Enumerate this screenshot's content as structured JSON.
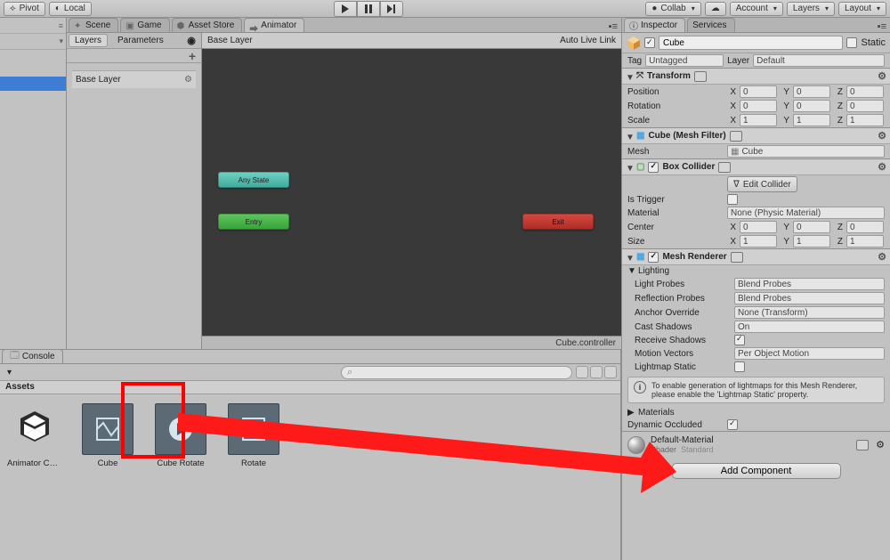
{
  "toolbar": {
    "pivot": "Pivot",
    "local": "Local",
    "collab": "Collab",
    "account": "Account",
    "layers": "Layers",
    "layout": "Layout"
  },
  "tabs": {
    "scene": "Scene",
    "game": "Game",
    "asset_store": "Asset Store",
    "animator": "Animator"
  },
  "animator": {
    "layers_tab": "Layers",
    "params_tab": "Parameters",
    "layer_name": "Base Layer",
    "breadcrumb": "Base Layer",
    "live": "Auto Live Link",
    "node_anystate": "Any State",
    "node_entry": "Entry",
    "node_exit": "Exit",
    "footer": "Cube.controller"
  },
  "console": {
    "tab": "Console"
  },
  "assets": {
    "title": "Assets",
    "items": [
      {
        "label": "Animator Co…",
        "kind": "unity"
      },
      {
        "label": "Cube",
        "kind": "anim"
      },
      {
        "label": "Cube Rotate",
        "kind": "clip"
      },
      {
        "label": "Rotate",
        "kind": "anim"
      }
    ]
  },
  "inspector": {
    "tab_inspector": "Inspector",
    "tab_services": "Services",
    "name": "Cube",
    "static": "Static",
    "tag_lbl": "Tag",
    "tag_val": "Untagged",
    "layer_lbl": "Layer",
    "layer_val": "Default",
    "transform": {
      "title": "Transform",
      "pos": "Position",
      "rot": "Rotation",
      "scl": "Scale",
      "px": "0",
      "py": "0",
      "pz": "0",
      "rx": "0",
      "ry": "0",
      "rz": "0",
      "sx": "1",
      "sy": "1",
      "sz": "1"
    },
    "meshfilter": {
      "title": "Cube (Mesh Filter)",
      "mesh_lbl": "Mesh",
      "mesh_val": "Cube"
    },
    "box": {
      "title": "Box Collider",
      "edit": "Edit Collider",
      "istrigger": "Is Trigger",
      "material": "Material",
      "mat_val": "None (Physic Material)",
      "center": "Center",
      "size": "Size",
      "cx": "0",
      "cy": "0",
      "cz": "0",
      "sx": "1",
      "sy": "1",
      "sz": "1"
    },
    "mesh": {
      "title": "Mesh Renderer",
      "lighting": "Lighting",
      "lp": "Light Probes",
      "lp_v": "Blend Probes",
      "rp": "Reflection Probes",
      "rp_v": "Blend Probes",
      "ao": "Anchor Override",
      "ao_v": "None (Transform)",
      "cs": "Cast Shadows",
      "cs_v": "On",
      "rs": "Receive Shadows",
      "mv": "Motion Vectors",
      "mv_v": "Per Object Motion",
      "ls": "Lightmap Static",
      "info": "To enable generation of lightmaps for this Mesh Renderer, please enable the 'Lightmap Static' property.",
      "mats": "Materials",
      "do": "Dynamic Occluded"
    },
    "material": {
      "title": "Default-Material",
      "shader_lbl": "Shader",
      "shader_val": "Standard"
    },
    "add": "Add Component"
  }
}
